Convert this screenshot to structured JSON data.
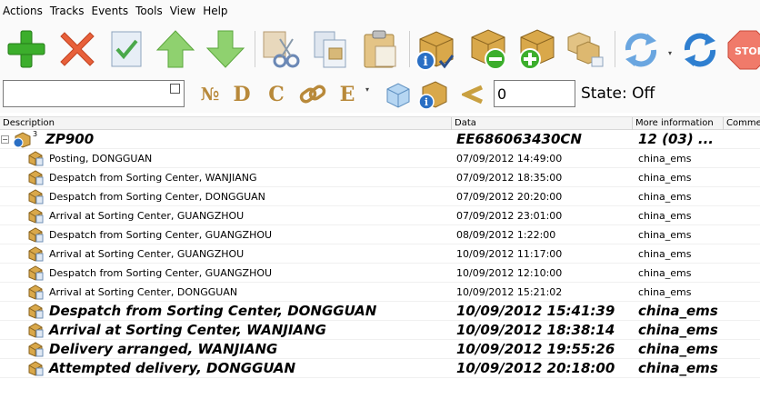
{
  "menu": [
    "Actions",
    "Tracks",
    "Events",
    "Tools",
    "View",
    "Help"
  ],
  "toolbar": {
    "buttons": [
      {
        "name": "add-button",
        "icon": "plus-icon"
      },
      {
        "name": "delete-button",
        "icon": "x-icon"
      },
      {
        "name": "check-button",
        "icon": "check-doc-icon"
      },
      {
        "name": "move-up-button",
        "icon": "arrow-up-icon"
      },
      {
        "name": "move-down-button",
        "icon": "arrow-down-icon"
      },
      {
        "name": "cut-button",
        "icon": "scissors-icon"
      },
      {
        "name": "copy-button",
        "icon": "copy-icon"
      },
      {
        "name": "paste-button",
        "icon": "clipboard-icon"
      },
      {
        "name": "package-info-button",
        "icon": "box-info-icon"
      },
      {
        "name": "package-remove-button",
        "icon": "box-minus-icon"
      },
      {
        "name": "package-add-button",
        "icon": "box-plus-icon"
      },
      {
        "name": "packages-button",
        "icon": "boxes-icon"
      },
      {
        "name": "refresh-button",
        "icon": "refresh-icon"
      },
      {
        "name": "refresh-all-button",
        "icon": "refresh-all-icon"
      },
      {
        "name": "stop-button",
        "icon": "stop-icon"
      }
    ],
    "stop_label": "STOP"
  },
  "filterbar": {
    "search_value": "",
    "letters": [
      "№",
      "D",
      "C",
      "E"
    ],
    "number_value": "0",
    "state_text": "State: Off"
  },
  "columns": [
    "Description",
    "Data",
    "More information",
    "Comment"
  ],
  "tree": {
    "root": {
      "badge": "3",
      "description": "ZP900",
      "data": "EE686063430CN",
      "info": "12 (03) ..."
    },
    "rows": [
      {
        "description": "Posting, DONGGUAN",
        "data": "07/09/2012 14:49:00",
        "info": "china_ems",
        "bold": false
      },
      {
        "description": "Despatch from Sorting Center, WANJIANG",
        "data": "07/09/2012 18:35:00",
        "info": "china_ems",
        "bold": false
      },
      {
        "description": "Despatch from Sorting Center, DONGGUAN",
        "data": "07/09/2012 20:20:00",
        "info": "china_ems",
        "bold": false
      },
      {
        "description": "Arrival at Sorting Center, GUANGZHOU",
        "data": "07/09/2012 23:01:00",
        "info": "china_ems",
        "bold": false
      },
      {
        "description": "Despatch from Sorting Center, GUANGZHOU",
        "data": "08/09/2012 1:22:00",
        "info": "china_ems",
        "bold": false
      },
      {
        "description": "Arrival at Sorting Center, GUANGZHOU",
        "data": "10/09/2012 11:17:00",
        "info": "china_ems",
        "bold": false
      },
      {
        "description": "Despatch from Sorting Center, GUANGZHOU",
        "data": "10/09/2012 12:10:00",
        "info": "china_ems",
        "bold": false
      },
      {
        "description": "Arrival at Sorting Center, DONGGUAN",
        "data": "10/09/2012 15:21:02",
        "info": "china_ems",
        "bold": false
      },
      {
        "description": "Despatch from Sorting Center, DONGGUAN",
        "data": "10/09/2012 15:41:39",
        "info": "china_ems",
        "bold": true
      },
      {
        "description": "Arrival at Sorting Center, WANJIANG",
        "data": "10/09/2012 18:38:14",
        "info": "china_ems",
        "bold": true
      },
      {
        "description": "Delivery arranged, WANJIANG",
        "data": "10/09/2012 19:55:26",
        "info": "china_ems",
        "bold": true
      },
      {
        "description": "Attempted delivery, DONGGUAN",
        "data": "10/09/2012 20:18:00",
        "info": "china_ems",
        "bold": true
      }
    ]
  }
}
